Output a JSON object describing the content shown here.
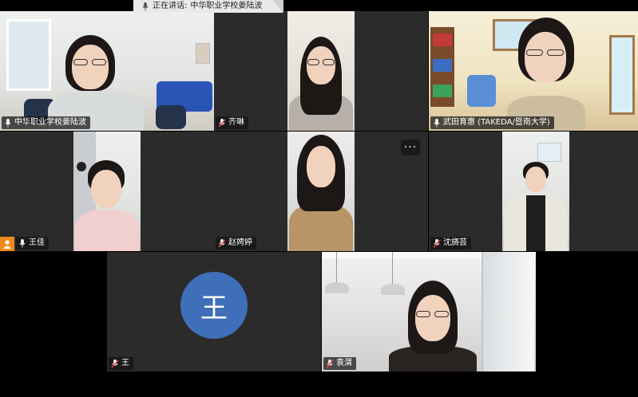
{
  "speaking_banner": {
    "prefix": "正在讲话:",
    "name": "中华职业学校姜陆波"
  },
  "participants": [
    {
      "name": "中华职业学校姜陆波",
      "muted": false
    },
    {
      "name": "齐琳",
      "muted": true
    },
    {
      "name": "武田育惠 (TAKEDA/暨南大学)",
      "muted": false
    },
    {
      "name": "王佳",
      "muted": false
    },
    {
      "name": "赵娉婷",
      "muted": true
    },
    {
      "name": "沈旖芸",
      "muted": true
    },
    {
      "name": "王",
      "muted": true,
      "avatar_initial": "王"
    },
    {
      "name": "袁渭",
      "muted": true
    }
  ],
  "more_button_label": "···",
  "colors": {
    "active_speaker": "#29c24a",
    "avatar_bg": "#3f6fb9",
    "muted_icon": "#e0463c",
    "host_badge": "#f08a1c"
  }
}
